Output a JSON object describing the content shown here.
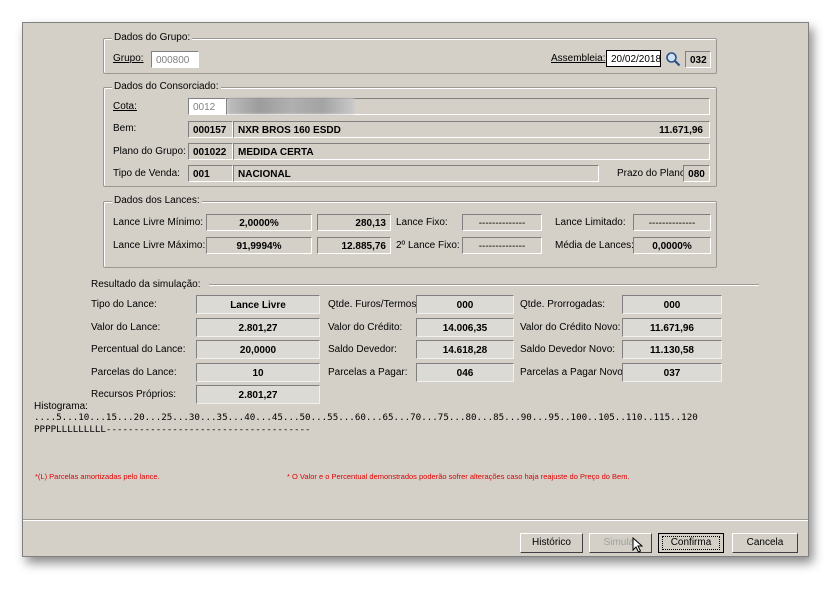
{
  "grupo": {
    "legend": "Dados do Grupo:",
    "grupo_label": "Grupo:",
    "grupo_value": "000800",
    "assembleia_label": "Assembleia:",
    "assembleia_value": "20/02/2018",
    "assembleia_code": "032"
  },
  "consorciado": {
    "legend": "Dados do Consorciado:",
    "cota_label": "Cota:",
    "cota_value": "0012",
    "bem_label": "Bem:",
    "bem_code": "000157",
    "bem_desc": "NXR BROS 160 ESDD",
    "bem_value": "11.671,96",
    "plano_label": "Plano do Grupo:",
    "plano_code": "001022",
    "plano_desc": "MEDIDA CERTA",
    "tipo_label": "Tipo de Venda:",
    "tipo_code": "001",
    "tipo_desc": "NACIONAL",
    "prazo_label": "Prazo do Plano:",
    "prazo_value": "080"
  },
  "lances": {
    "legend": "Dados dos Lances:",
    "min_label": "Lance Livre Mínimo:",
    "min_pct": "2,0000%",
    "min_value": "280,13",
    "fixo_label": "Lance Fixo:",
    "fixo_value": "--------------",
    "limitado_label": "Lance Limitado:",
    "limitado_value": "--------------",
    "max_label": "Lance Livre Máximo:",
    "max_pct": "91,9994%",
    "max_value": "12.885,76",
    "fixo2_label": "2º Lance Fixo:",
    "fixo2_value": "--------------",
    "media_label": "Média de Lances:",
    "media_value": "0,0000%"
  },
  "resultado": {
    "title": "Resultado da simulação:",
    "tipo_lance_label": "Tipo do Lance:",
    "tipo_lance_value": "Lance Livre",
    "furos_label": "Qtde. Furos/Termos:",
    "furos_value": "000",
    "prorrog_label": "Qtde. Prorrogadas:",
    "prorrog_value": "000",
    "valor_lance_label": "Valor do Lance:",
    "valor_lance_value": "2.801,27",
    "valor_credito_label": "Valor do Crédito:",
    "valor_credito_value": "14.006,35",
    "credito_novo_label": "Valor do Crédito Novo:",
    "credito_novo_value": "11.671,96",
    "pct_lance_label": "Percentual do Lance:",
    "pct_lance_value": "20,0000",
    "saldo_label": "Saldo Devedor:",
    "saldo_value": "14.618,28",
    "saldo_novo_label": "Saldo Devedor Novo:",
    "saldo_novo_value": "11.130,58",
    "parc_lance_label": "Parcelas do Lance:",
    "parc_lance_value": "10",
    "parc_pagar_label": "Parcelas a Pagar:",
    "parc_pagar_value": "046",
    "parc_pagar_novo_label": "Parcelas a Pagar Novo:",
    "parc_pagar_novo_value": "037",
    "recursos_label": "Recursos Próprios:",
    "recursos_value": "2.801,27"
  },
  "histograma": {
    "label": "Histograma:",
    "scale": "....5...10...15...20...25...30...35...40...45...50...55...60...65...70...75...80...85...90...95..100..105..110..115..120",
    "bar": "PPPPLLLLLLLLL-------------------------------------"
  },
  "notes": {
    "left": "*(L) Parcelas amortizadas pelo lance.",
    "right": "* O Valor e o Percentual demonstrados poderão sofrer alterações caso haja reajuste do Preço do Bem."
  },
  "buttons": {
    "historico": "Histórico",
    "simular": "Simular",
    "confirma": "Confirma",
    "cancela": "Cancela"
  },
  "colors": {
    "panel": "#d4d0c8",
    "note_red": "#e00000"
  }
}
